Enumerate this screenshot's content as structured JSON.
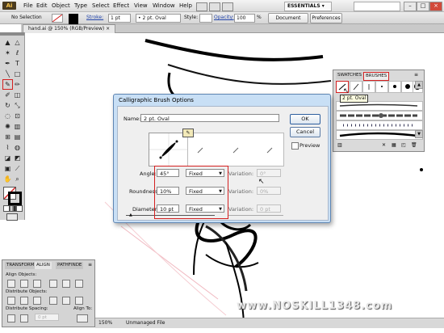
{
  "app": {
    "logo": "Ai"
  },
  "menu": [
    "File",
    "Edit",
    "Object",
    "Type",
    "Select",
    "Effect",
    "View",
    "Window",
    "Help"
  ],
  "workspace": "ESSENTIALS",
  "control_bar": {
    "selection": "No Selection",
    "stroke_label": "Stroke:",
    "stroke_weight": "1 pt",
    "brush_name": "2 pt. Oval",
    "style_label": "Style:",
    "opacity_label": "Opacity:",
    "opacity_value": "100",
    "opacity_unit": "%",
    "doc_setup": "Document Setup",
    "preferences": "Preferences"
  },
  "document_tab": "hand.ai @ 150% (RGB/Preview)",
  "brush_panel": {
    "tabs": [
      "SWATCHES",
      "BRUSHES"
    ],
    "tooltip": "2 pt. Oval"
  },
  "dialog": {
    "title": "Calligraphic Brush Options",
    "name_label": "Name:",
    "name_value": "2 pt. Oval",
    "ok": "OK",
    "cancel": "Cancel",
    "preview": "Preview",
    "angle_label": "Angle:",
    "angle_value": "45°",
    "angle_mode": "Fixed",
    "angle_variation_label": "Variation:",
    "angle_variation": "0°",
    "roundness_label": "Roundness:",
    "roundness_value": "10%",
    "roundness_mode": "Fixed",
    "roundness_variation_label": "Variation:",
    "roundness_variation": "0%",
    "diameter_label": "Diameter:",
    "diameter_value": "10 pt",
    "diameter_mode": "Fixed",
    "diameter_variation_label": "Variation:",
    "diameter_variation": "0 pt"
  },
  "align_panel": {
    "tabs": [
      "TRANSFORM",
      "ALIGN",
      "PATHFINDE"
    ],
    "align_objects": "Align Objects:",
    "distribute_objects": "Distribute Objects:",
    "distribute_spacing": "Distribute Spacing:",
    "align_to": "Align To:",
    "spacing_value": "0 pt"
  },
  "status_bar": {
    "zoom": "150%",
    "info": "Unmanaged File"
  },
  "watermark": "www.NOSKILL1348.com",
  "colors": {
    "highlight": "#d42020",
    "dialog_frame": "#c8dff5"
  }
}
